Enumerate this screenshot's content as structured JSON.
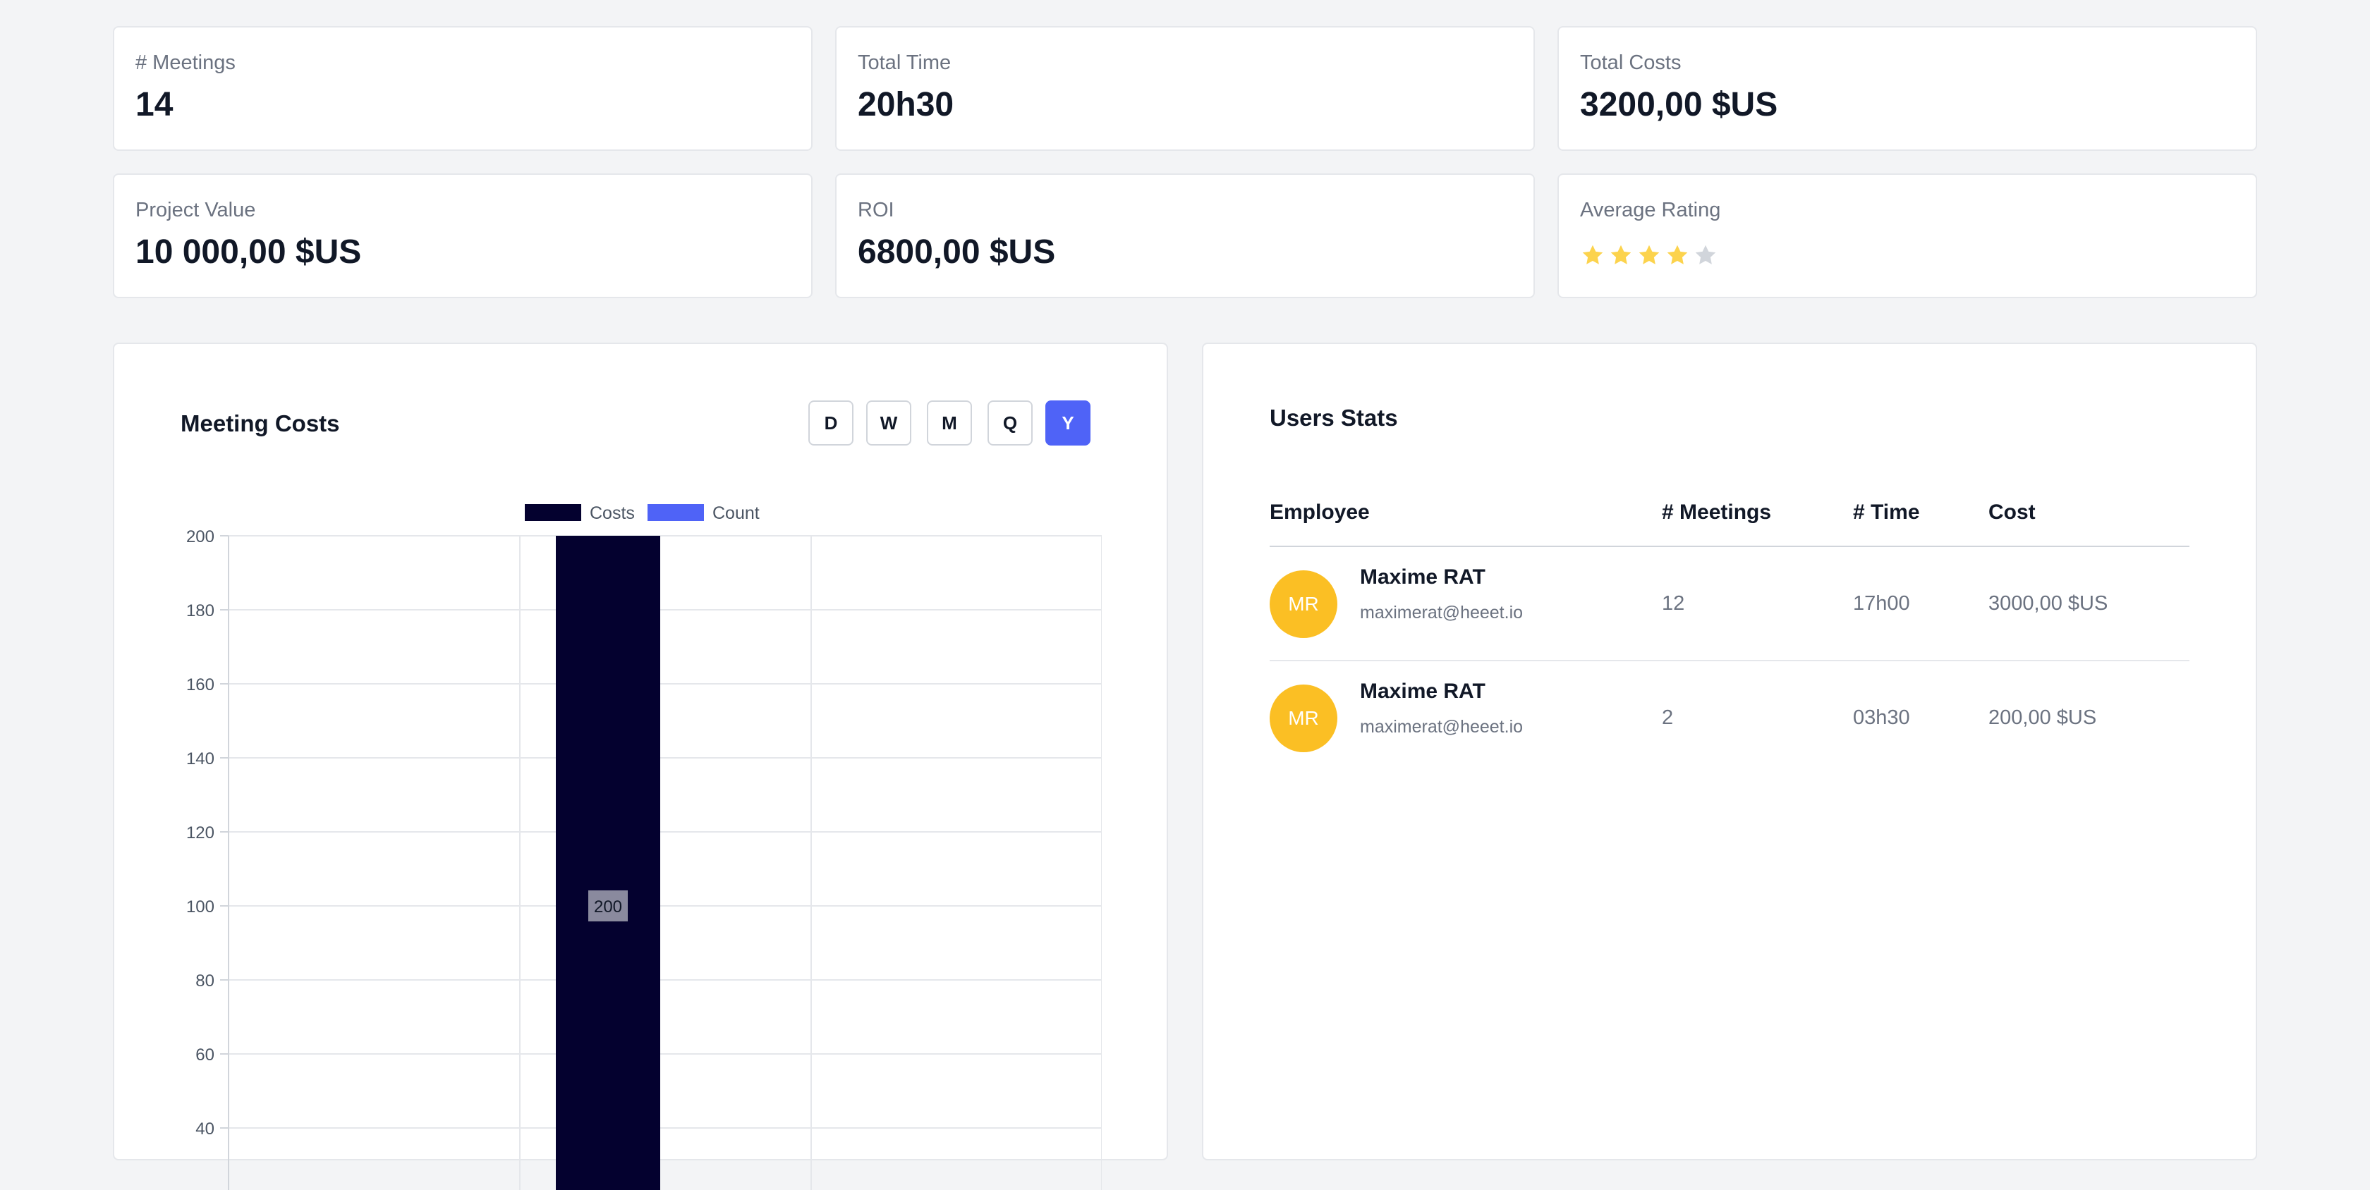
{
  "stats": [
    {
      "label": "# Meetings",
      "value": "14"
    },
    {
      "label": "Total Time",
      "value": "20h30"
    },
    {
      "label": "Total Costs",
      "value": "3200,00 $US"
    },
    {
      "label": "Project Value",
      "value": "10 000,00 $US"
    },
    {
      "label": "ROI",
      "value": "6800,00 $US"
    },
    {
      "label": "Average Rating",
      "rating": 4,
      "max_rating": 5
    }
  ],
  "meeting_costs": {
    "title": "Meeting Costs",
    "ranges": [
      "D",
      "W",
      "M",
      "Q",
      "Y"
    ],
    "active_range": "Y"
  },
  "chart_data": {
    "type": "bar",
    "legend": [
      "Costs",
      "Count"
    ],
    "legend_position": "top",
    "series": [
      {
        "name": "Costs",
        "color": "#04012f",
        "values": [
          200
        ]
      },
      {
        "name": "Count",
        "color": "#4f63f7",
        "values": [
          0
        ]
      }
    ],
    "data_labels": [
      "200"
    ],
    "ylim": [
      0,
      200
    ],
    "y_ticks": [
      200,
      180,
      160,
      140,
      120,
      100,
      80,
      60,
      40
    ],
    "grid": true
  },
  "users_stats": {
    "title": "Users Stats",
    "columns": [
      "Employee",
      "# Meetings",
      "# Time",
      "Cost"
    ],
    "rows": [
      {
        "initials": "MR",
        "name": "Maxime RAT",
        "email": "maximerat@heeet.io",
        "meetings": "12",
        "time": "17h00",
        "cost": "3000,00 $US"
      },
      {
        "initials": "MR",
        "name": "Maxime RAT",
        "email": "maximerat@heeet.io",
        "meetings": "2",
        "time": "03h30",
        "cost": "200,00 $US"
      }
    ]
  },
  "colors": {
    "accent": "#4f63f7",
    "bar": "#04012f",
    "avatar": "#fbbf24",
    "star": "#fcd34d",
    "star_empty": "#d1d5db"
  }
}
